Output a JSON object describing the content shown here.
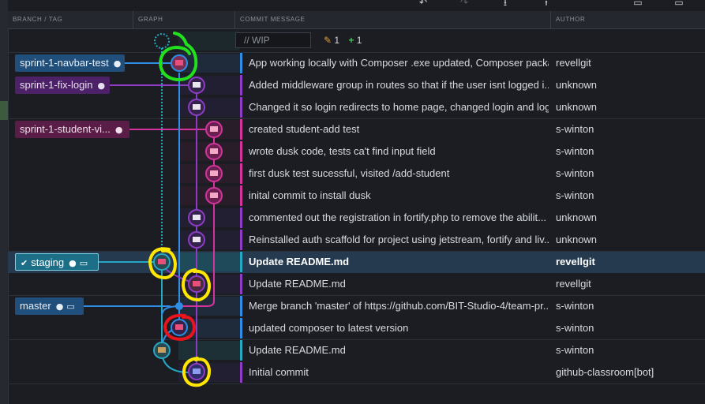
{
  "toolbar": {
    "icons": [
      "undo-icon",
      "redo-icon",
      "pull-icon",
      "push-icon",
      "stash-icon",
      "pop-icon"
    ]
  },
  "header": {
    "branch_tag": "BRANCH / TAG",
    "graph": "GRAPH",
    "commit_message": "COMMIT MESSAGE",
    "author": "AUTHOR"
  },
  "wip": {
    "placeholder": "// WIP",
    "modified_count": "1",
    "added_count": "1"
  },
  "branches": {
    "navbar": "sprint-1-navbar-test",
    "fix_login": "sprint-1-fix-login",
    "student_view": "sprint-1-student-vi...",
    "staging": "staging",
    "master": "master"
  },
  "commits": [
    {
      "message": "App working locally with Composer .exe updated, Composer packa...",
      "author": "revellgit"
    },
    {
      "message": "Added middleware group in routes so that if the user isnt logged i...",
      "author": "unknown"
    },
    {
      "message": "Changed it so login redirects to home page, changed login and log...",
      "author": "unknown"
    },
    {
      "message": "created student-add test",
      "author": "s-winton"
    },
    {
      "message": "wrote dusk code, tests ca't find input field",
      "author": "s-winton"
    },
    {
      "message": "first dusk test sucessful, visited /add-student",
      "author": "s-winton"
    },
    {
      "message": "inital commit to install dusk",
      "author": "s-winton"
    },
    {
      "message": "commented out the registration in fortify.php to remove the abilit...",
      "author": "unknown"
    },
    {
      "message": "Reinstalled auth scaffold for project using jetstream, fortify and liv...",
      "author": "unknown"
    },
    {
      "message": "Update README.md",
      "author": "revellgit"
    },
    {
      "message": "Update README.md",
      "author": "revellgit"
    },
    {
      "message": "Merge branch 'master' of https://github.com/BIT-Studio-4/team-pr...",
      "author": "s-winton"
    },
    {
      "message": "updated composer to latest version",
      "author": "s-winton"
    },
    {
      "message": "Update README.md",
      "author": "s-winton"
    },
    {
      "message": "Initial commit",
      "author": "github-classroom[bot]"
    }
  ],
  "colors": {
    "blue": "#2f8de4",
    "purple": "#8e3cc4",
    "magenta": "#d2349c",
    "teal": "#24a8c4",
    "annotation_green": "#22e01e",
    "annotation_yellow": "#ffe600",
    "annotation_red": "#e8141e"
  }
}
